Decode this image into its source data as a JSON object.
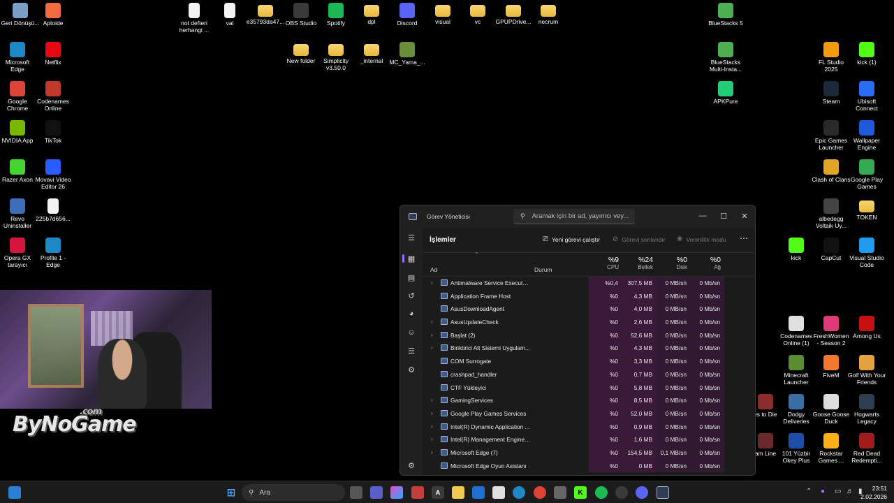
{
  "desktop": {
    "icons": [
      {
        "label": "Geri Dönüşü...",
        "glyph": "trash-icon",
        "color": "#7aa0c8",
        "type": "app"
      },
      {
        "label": "Aptoide",
        "glyph": "aptoide-icon",
        "color": "#f26a3f",
        "type": "app"
      },
      {
        "label": "not defteri herhangi ...",
        "glyph": "document-icon",
        "color": "#ffffff",
        "type": "doc"
      },
      {
        "label": "val",
        "glyph": "document-icon",
        "color": "#ffffff",
        "type": "doc"
      },
      {
        "label": "e35793da47...",
        "glyph": "folder-icon",
        "color": "#f0c94e",
        "type": "folder"
      },
      {
        "label": "OBS Studio",
        "glyph": "obs-icon",
        "color": "#3a3a3a",
        "type": "app"
      },
      {
        "label": "Spotify",
        "glyph": "spotify-icon",
        "color": "#1db954",
        "type": "app"
      },
      {
        "label": "dpl",
        "glyph": "folder-icon",
        "color": "#f0c94e",
        "type": "folder"
      },
      {
        "label": "Discord",
        "glyph": "discord-icon",
        "color": "#5865f2",
        "type": "app"
      },
      {
        "label": "visual",
        "glyph": "folder-icon",
        "color": "#f0c94e",
        "type": "folder"
      },
      {
        "label": "vc",
        "glyph": "folder-icon",
        "color": "#f0c94e",
        "type": "folder"
      },
      {
        "label": "GPUPDrive...",
        "glyph": "folder-icon",
        "color": "#f0c94e",
        "type": "folder"
      },
      {
        "label": "necrum",
        "glyph": "folder-icon",
        "color": "#f0c94e",
        "type": "folder"
      },
      {
        "label": "BlueStacks 5",
        "glyph": "bluestacks-icon",
        "color": "#4caf50",
        "type": "app"
      },
      {
        "label": "Microsoft Edge",
        "glyph": "edge-icon",
        "color": "#1e88c7",
        "type": "app"
      },
      {
        "label": "Netflix",
        "glyph": "netflix-icon",
        "color": "#e50914",
        "type": "app"
      },
      {
        "label": "New folder",
        "glyph": "folder-icon",
        "color": "#f0c94e",
        "type": "folder"
      },
      {
        "label": "Simplicity v3.50.0",
        "glyph": "folder-icon",
        "color": "#f0c94e",
        "type": "folder"
      },
      {
        "label": "_internal",
        "glyph": "folder-icon",
        "color": "#f0c94e",
        "type": "folder"
      },
      {
        "label": "MC_Yama_...",
        "glyph": "mc-icon",
        "color": "#6a8f3a",
        "type": "app"
      },
      {
        "label": "BlueStacks Multi-Insta...",
        "glyph": "bluestacks-multi-icon",
        "color": "#4caf50",
        "type": "app"
      },
      {
        "label": "FL Studio 2025",
        "glyph": "flstudio-icon",
        "color": "#f39c12",
        "type": "app"
      },
      {
        "label": "kick (1)",
        "glyph": "kick-icon",
        "color": "#53fc18",
        "type": "app"
      },
      {
        "label": "Google Chrome",
        "glyph": "chrome-icon",
        "color": "#db4437",
        "type": "app"
      },
      {
        "label": "Codenames Online",
        "glyph": "codenames-icon",
        "color": "#c0392b",
        "type": "app"
      },
      {
        "label": "APKPure",
        "glyph": "apkpure-icon",
        "color": "#24cd77",
        "type": "app"
      },
      {
        "label": "Steam",
        "glyph": "steam-icon",
        "color": "#1b2838",
        "type": "app"
      },
      {
        "label": "Ubisoft Connect",
        "glyph": "ubisoft-icon",
        "color": "#2a6df4",
        "type": "app"
      },
      {
        "label": "NVIDIA App",
        "glyph": "nvidia-icon",
        "color": "#76b900",
        "type": "app"
      },
      {
        "label": "TikTok",
        "glyph": "tiktok-icon",
        "color": "#111111",
        "type": "app"
      },
      {
        "label": "Epic Games Launcher",
        "glyph": "epic-icon",
        "color": "#2a2a2a",
        "type": "app"
      },
      {
        "label": "Wallpaper Engine",
        "glyph": "wallpaper-engine-icon",
        "color": "#1e5bd8",
        "type": "app"
      },
      {
        "label": "Razer Axon",
        "glyph": "razer-icon",
        "color": "#44d62c",
        "type": "app"
      },
      {
        "label": "Movavi Video Editor 26",
        "glyph": "movavi-icon",
        "color": "#2a5bff",
        "type": "app"
      },
      {
        "label": "Clash of Clans",
        "glyph": "clash-icon",
        "color": "#e0a526",
        "type": "app"
      },
      {
        "label": "Google Play Games",
        "glyph": "playgames-icon",
        "color": "#34a853",
        "type": "app"
      },
      {
        "label": "Revo Uninstaller",
        "glyph": "revo-icon",
        "color": "#3c6fb6",
        "type": "app"
      },
      {
        "label": "225b7d656...",
        "glyph": "document-icon",
        "color": "#ffffff",
        "type": "doc"
      },
      {
        "label": "albedegg Voltaik Uy...",
        "glyph": "albedegg-icon",
        "color": "#444444",
        "type": "app"
      },
      {
        "label": "TOKEN",
        "glyph": "folder-icon",
        "color": "#f0c94e",
        "type": "folder"
      },
      {
        "label": "Opera GX tarayıcı",
        "glyph": "operagx-icon",
        "color": "#d4163c",
        "type": "app"
      },
      {
        "label": "Profile 1 - Edge",
        "glyph": "edge-icon",
        "color": "#1e88c7",
        "type": "app"
      },
      {
        "label": "kick",
        "glyph": "kick-icon",
        "color": "#53fc18",
        "type": "app"
      },
      {
        "label": "CapCut",
        "glyph": "capcut-icon",
        "color": "#111111",
        "type": "app"
      },
      {
        "label": "Visual Studio Code",
        "glyph": "vscode-icon",
        "color": "#1f9cf0",
        "type": "app"
      },
      {
        "label": "Codenames Online (1)",
        "glyph": "codenames-icon",
        "color": "#e0e0e0",
        "type": "app"
      },
      {
        "label": "FreshWomen - Season 2",
        "glyph": "freshwomen-icon",
        "color": "#e03a7a",
        "type": "app"
      },
      {
        "label": "Among Us",
        "glyph": "amongus-icon",
        "color": "#c51111",
        "type": "app"
      },
      {
        "label": "Minecraft Launcher",
        "glyph": "minecraft-icon",
        "color": "#5b8c32",
        "type": "app"
      },
      {
        "label": "FiveM",
        "glyph": "fivem-icon",
        "color": "#f2762e",
        "type": "app"
      },
      {
        "label": "Golf With Your Friends",
        "glyph": "golf-icon",
        "color": "#e6a23c",
        "type": "app"
      },
      {
        "label": "ys to Die",
        "glyph": "game-icon",
        "color": "#8b2b2b",
        "type": "app"
      },
      {
        "label": "Dodgy Deliveries",
        "glyph": "dodgy-icon",
        "color": "#3a6ea5",
        "type": "app"
      },
      {
        "label": "Goose Goose Duck",
        "glyph": "goose-icon",
        "color": "#dddddd",
        "type": "app"
      },
      {
        "label": "Hogwarts Legacy",
        "glyph": "hogwarts-icon",
        "color": "#2c3e50",
        "type": "app"
      },
      {
        "label": "am Line",
        "glyph": "game-icon",
        "color": "#6b2a2a",
        "type": "app"
      },
      {
        "label": "101 Yüzbir Okey Plus",
        "glyph": "okey-icon",
        "color": "#1e4fa8",
        "type": "app"
      },
      {
        "label": "Rockstar Games ...",
        "glyph": "rockstar-icon",
        "color": "#fcaf17",
        "type": "app"
      },
      {
        "label": "Red Dead Redempti...",
        "glyph": "rdr-icon",
        "color": "#a11d1d",
        "type": "app"
      }
    ]
  },
  "webcam": {
    "overlay_logo": "ByNoGame",
    "overlay_logo_suffix": ".com"
  },
  "taskmanager": {
    "title": "Görev Yöneticisi",
    "search_placeholder": "Aramak için bir ad, yayımcı vey...",
    "page_title": "İşlemler",
    "toolbar": {
      "run_new": "Yeni görevi çalıştır",
      "end_task": "Görevi sonlandır",
      "efficiency": "Verimlilik modu"
    },
    "columns": {
      "name": "Ad",
      "status": "Durum",
      "cpu_pct": "%9",
      "cpu": "CPU",
      "mem_pct": "%24",
      "mem": "Bellek",
      "disk_pct": "%0",
      "disk": "Disk",
      "net_pct": "%0",
      "net": "Ağ"
    },
    "processes": [
      {
        "name": "Antimalware Service Executable",
        "expandable": true,
        "cpu": "%0,4",
        "mem": "307,5 MB",
        "disk": "0 MB/sn",
        "net": "0 Mb/sn"
      },
      {
        "name": "Application Frame Host",
        "expandable": false,
        "cpu": "%0",
        "mem": "4,3 MB",
        "disk": "0 MB/sn",
        "net": "0 Mb/sn"
      },
      {
        "name": "AsusDownloadAgent",
        "expandable": false,
        "cpu": "%0",
        "mem": "4,0 MB",
        "disk": "0 MB/sn",
        "net": "0 Mb/sn"
      },
      {
        "name": "AsusUpdateCheck",
        "expandable": true,
        "cpu": "%0",
        "mem": "2,6 MB",
        "disk": "0 MB/sn",
        "net": "0 Mb/sn"
      },
      {
        "name": "Başlat (2)",
        "expandable": true,
        "cpu": "%0",
        "mem": "52,6 MB",
        "disk": "0 MB/sn",
        "net": "0 Mb/sn"
      },
      {
        "name": "Biriktirici Alt Sistemi Uygulam...",
        "expandable": true,
        "cpu": "%0",
        "mem": "4,3 MB",
        "disk": "0 MB/sn",
        "net": "0 Mb/sn"
      },
      {
        "name": "COM Surrogate",
        "expandable": false,
        "cpu": "%0",
        "mem": "3,3 MB",
        "disk": "0 MB/sn",
        "net": "0 Mb/sn"
      },
      {
        "name": "crashpad_handler",
        "expandable": false,
        "cpu": "%0",
        "mem": "0,7 MB",
        "disk": "0 MB/sn",
        "net": "0 Mb/sn"
      },
      {
        "name": "CTF Yükleyici",
        "expandable": false,
        "cpu": "%0",
        "mem": "5,8 MB",
        "disk": "0 MB/sn",
        "net": "0 Mb/sn"
      },
      {
        "name": "GamingServices",
        "expandable": true,
        "cpu": "%0",
        "mem": "8,5 MB",
        "disk": "0 MB/sn",
        "net": "0 Mb/sn"
      },
      {
        "name": "Google Play Games Services",
        "expandable": true,
        "cpu": "%0",
        "mem": "52,0 MB",
        "disk": "0 MB/sn",
        "net": "0 Mb/sn"
      },
      {
        "name": "Intel(R) Dynamic Application ...",
        "expandable": true,
        "cpu": "%0",
        "mem": "0,9 MB",
        "disk": "0 MB/sn",
        "net": "0 Mb/sn"
      },
      {
        "name": "Intel(R) Management Engine ...",
        "expandable": true,
        "cpu": "%0",
        "mem": "1,6 MB",
        "disk": "0 MB/sn",
        "net": "0 Mb/sn"
      },
      {
        "name": "Microsoft Edge (7)",
        "expandable": true,
        "cpu": "%0",
        "mem": "154,5 MB",
        "disk": "0,1 MB/sn",
        "net": "0 Mb/sn"
      },
      {
        "name": "Microsoft Edge Oyun Asistanı",
        "expandable": false,
        "cpu": "%0",
        "mem": "0 MB",
        "disk": "0 MB/sn",
        "net": "0 Mb/sn"
      }
    ]
  },
  "taskbar": {
    "search_placeholder": "Ara",
    "time": "23:51",
    "date": "2.02.2026"
  }
}
